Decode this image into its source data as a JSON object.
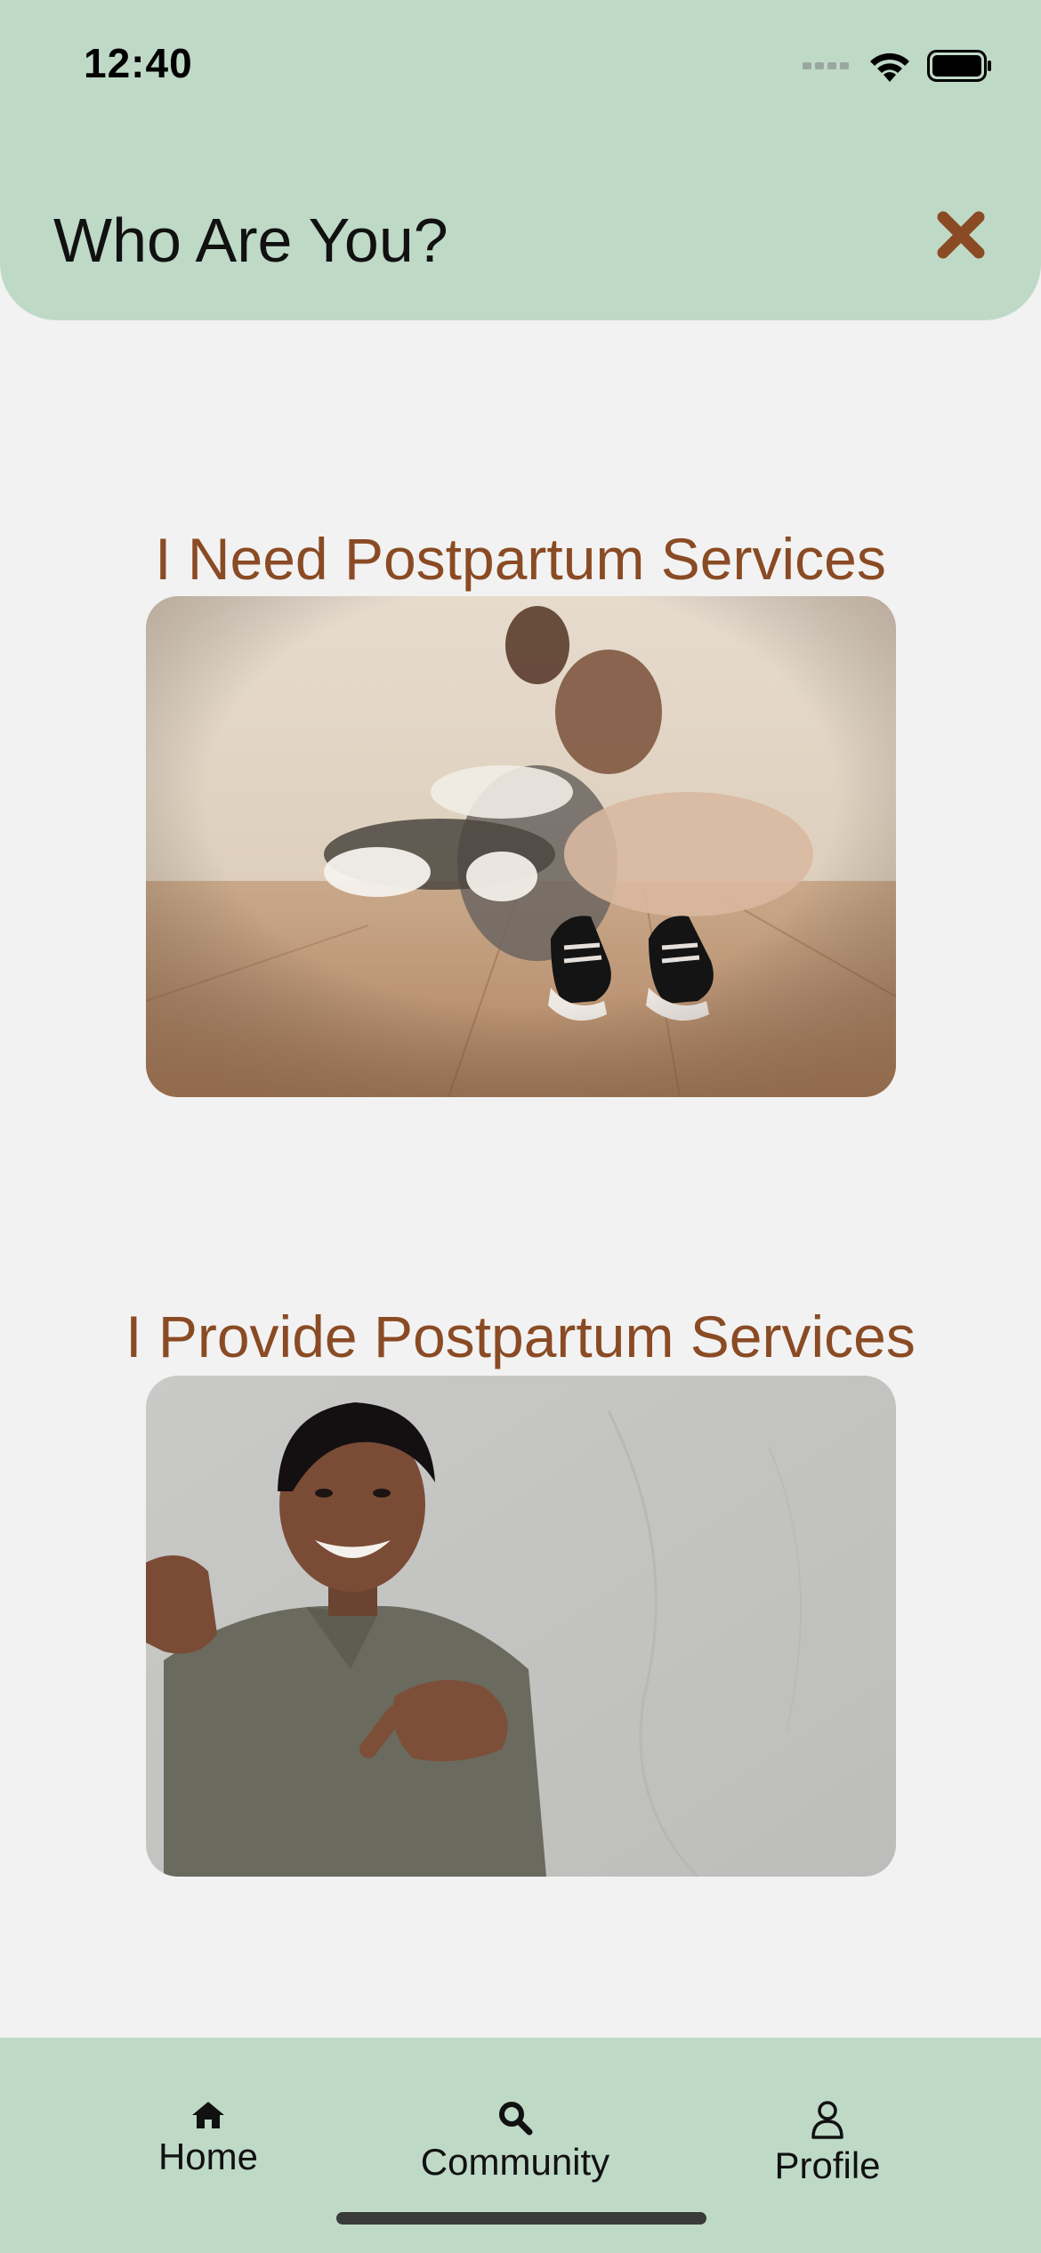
{
  "status_bar": {
    "time": "12:40"
  },
  "header": {
    "title": "Who Are You?",
    "close_icon": "close-icon"
  },
  "options": [
    {
      "title": "I Need Postpartum Services",
      "image": "family-with-baby-shoes-photo"
    },
    {
      "title": "I Provide Postpartum Services",
      "image": "smiling-woman-pointing-photo"
    }
  ],
  "tabs": [
    {
      "label": "Home",
      "icon": "home-icon"
    },
    {
      "label": "Community",
      "icon": "search-icon"
    },
    {
      "label": "Profile",
      "icon": "person-icon"
    }
  ],
  "colors": {
    "header_bg": "#bfd9c7",
    "accent": "#8a4b24",
    "page_bg": "#f2f2f2"
  }
}
